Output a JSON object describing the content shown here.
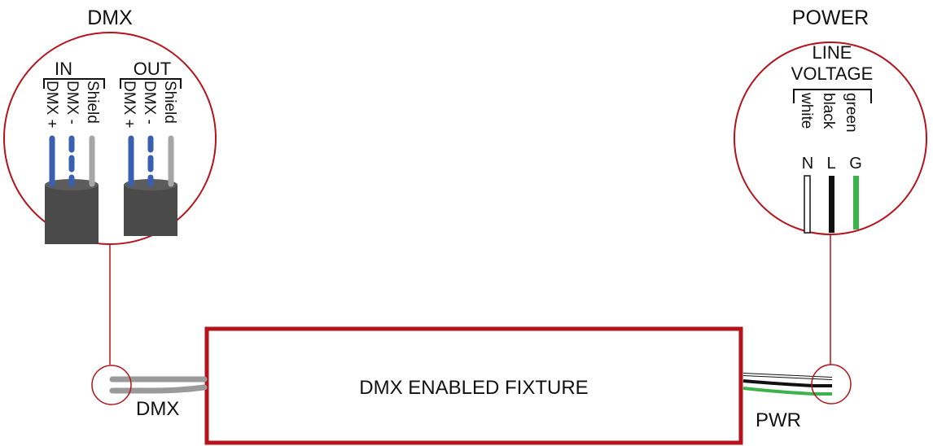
{
  "dmx_detail": {
    "title": "DMX",
    "in_label": "IN",
    "out_label": "OUT",
    "in_pins": [
      "DMX +",
      "DMX -",
      "Shield"
    ],
    "out_pins": [
      "DMX +",
      "DMX -",
      "Shield"
    ]
  },
  "power_detail": {
    "title": "POWER",
    "line_voltage": [
      "LINE",
      "VOLTAGE"
    ],
    "wire_colors": [
      "white",
      "black",
      "green"
    ],
    "wire_codes": [
      "N",
      "L",
      "G"
    ]
  },
  "fixture": {
    "label": "DMX ENABLED FIXTURE",
    "dmx_port_label": "DMX",
    "pwr_port_label": "PWR"
  },
  "colors": {
    "accent_red": "#b5121b",
    "dmx_blue": "#3a5fb0",
    "shield_gray": "#a6a6a6",
    "cable_dark": "#4a4a4a",
    "ground_green": "#3cb34a"
  }
}
